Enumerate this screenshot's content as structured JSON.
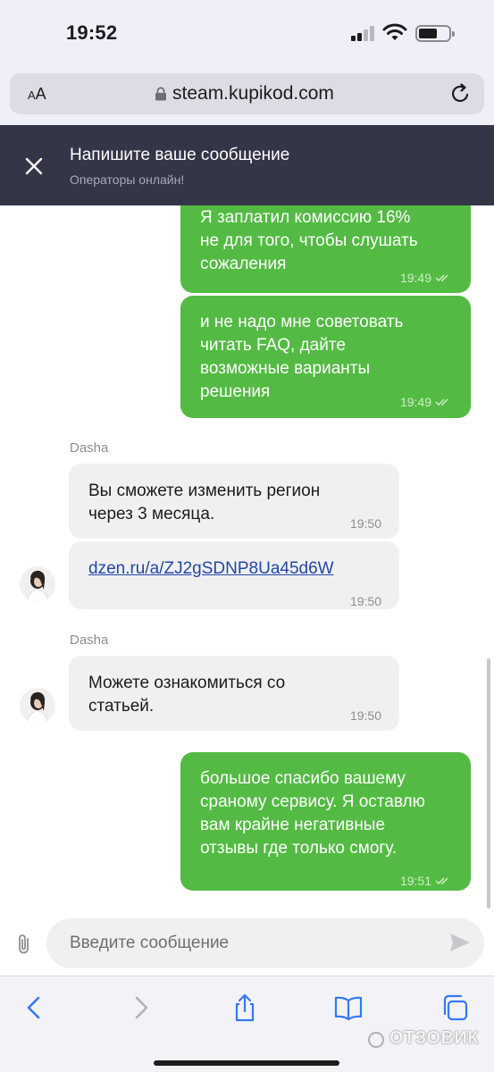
{
  "status": {
    "time": "19:52"
  },
  "address_bar": {
    "text_size_label": "AA",
    "url": "steam.kupikod.com"
  },
  "chat": {
    "header_title": "Напишите ваше сообщение",
    "header_subtitle": "Операторы онлайн!",
    "messages": [
      {
        "from": "user",
        "lines": [
          "Я заплатил комиссию 16%",
          "не для того, чтобы слушать",
          "сожаления"
        ],
        "time": "19:49"
      },
      {
        "from": "user",
        "lines": [
          "и не надо мне советовать",
          "читать FAQ, дайте",
          "возможные варианты",
          "решения"
        ],
        "time": "19:49"
      },
      {
        "from": "operator",
        "sender": "Dasha",
        "lines": [
          "Вы сможете изменить регион",
          "через 3 месяца."
        ],
        "time": "19:50"
      },
      {
        "from": "operator",
        "link": "dzen.ru/a/ZJ2gSDNP8Ua45d6W",
        "time": "19:50"
      },
      {
        "from": "operator",
        "sender": "Dasha",
        "lines": [
          "Можете ознакомиться со",
          "статьей."
        ],
        "time": "19:50"
      },
      {
        "from": "user",
        "lines": [
          "большое спасибо вашему",
          "сраному сервису. Я оставлю",
          "вам крайне негативные",
          "отзывы где только смогу."
        ],
        "time": "19:51"
      }
    ],
    "input_placeholder": "Введите сообщение"
  },
  "watermark": "ОТЗОВИК",
  "colors": {
    "outgoing_bubble": "#53bb43",
    "incoming_bubble": "#f0f0f2",
    "header_bg": "#343648",
    "link": "#2347a8"
  }
}
